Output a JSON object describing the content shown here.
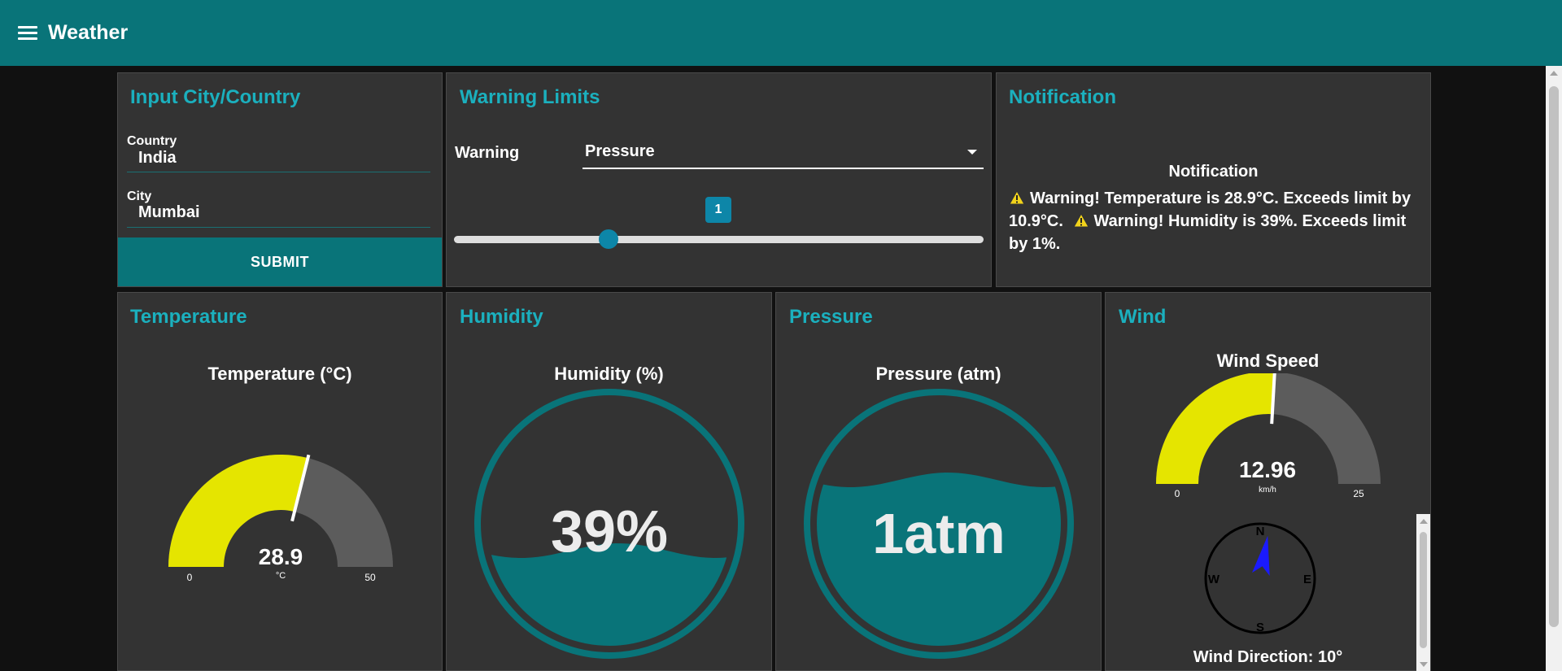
{
  "header": {
    "title": "Weather",
    "menu_icon": "hamburger-menu-icon"
  },
  "input_panel": {
    "title": "Input City/Country",
    "country_label": "Country",
    "country_value": "India",
    "city_label": "City",
    "city_value": "Mumbai",
    "submit_label": "SUBMIT"
  },
  "warning_panel": {
    "title": "Warning Limits",
    "label": "Warning",
    "selected": "Pressure",
    "slider_value": "1",
    "slider_fraction": 0.3
  },
  "notification_panel": {
    "title": "Notification",
    "heading": "Notification",
    "messages": [
      "Warning! Temperature is 28.9°C. Exceeds limit by 10.9°C.",
      "Warning! Humidity is 39%. Exceeds limit by 1%."
    ]
  },
  "temperature_panel": {
    "title": "Temperature",
    "gauge_title": "Temperature (°C)",
    "value": "28.9",
    "unit": "°C",
    "min": "0",
    "max": "50",
    "fraction": 0.578
  },
  "humidity_panel": {
    "title": "Humidity",
    "gauge_title": "Humidity (%)",
    "value": "39%",
    "level": 0.39
  },
  "pressure_panel": {
    "title": "Pressure",
    "gauge_title": "Pressure (atm)",
    "value": "1atm",
    "level": 0.68
  },
  "wind_panel": {
    "title": "Wind",
    "gauge_title": "Wind Speed",
    "value": "12.96",
    "unit": "km/h",
    "min": "0",
    "max": "25",
    "fraction": 0.518,
    "compass": {
      "n": "N",
      "e": "E",
      "s": "S",
      "w": "W"
    },
    "direction_label": "Wind Direction: 10°"
  },
  "colors": {
    "header": "#097479",
    "panel": "#333333",
    "accent_title": "#1bb0be",
    "gauge_fill": "#e5e500",
    "gauge_empty": "#5c5c5c",
    "liquid": "#097479",
    "slider": "#0d86a8",
    "compass_needle": "#1a1aff"
  }
}
